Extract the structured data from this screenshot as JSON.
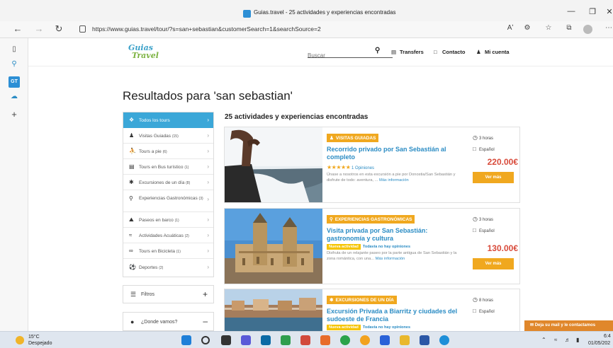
{
  "window": {
    "tab_title": "Guias.travel - 25 actividades y experiencias encontradas",
    "favicon_icon": "gt-favicon"
  },
  "browser": {
    "url": "https://www.guias.travel/tour/?s=san+sebastian&customerSearch=1&searchSource=2",
    "read_aloud": "Aʹ"
  },
  "header": {
    "logo_line1": "Guias",
    "logo_line2": "Travel",
    "search_placeholder": "Buscar",
    "transfers": "Transfers",
    "contacto": "Contacto",
    "mi_cuenta": "Mi cuenta"
  },
  "page": {
    "title": "Resultados para 'san sebastian'",
    "results_count": "25 actividades y experiencias encontradas"
  },
  "categories": [
    {
      "label": "Todos los tours",
      "count": "",
      "icon": "tag-icon",
      "active": true
    },
    {
      "label": "Visitas Guiadas",
      "count": "(15)",
      "icon": "guide-icon"
    },
    {
      "label": "Tours a pie",
      "count": "(6)",
      "icon": "walker-icon"
    },
    {
      "label": "Tours en Bus turístico",
      "count": "(1)",
      "icon": "bus-icon"
    },
    {
      "label": "Excursiones de un día",
      "count": "(8)",
      "icon": "hiker-icon"
    },
    {
      "label": "Experiencias Gastronómicas",
      "count": "(3)",
      "icon": "food-icon"
    },
    {
      "label": "Paseos en barco",
      "count": "(1)",
      "icon": "boat-icon"
    },
    {
      "label": "Actividades Acuáticas",
      "count": "(2)",
      "icon": "water-icon"
    },
    {
      "label": "Tours en Bicicleta",
      "count": "(1)",
      "icon": "bicycle-icon"
    },
    {
      "label": "Deportes",
      "count": "(2)",
      "icon": "sports-icon"
    }
  ],
  "filters": {
    "label": "Filtros",
    "where_placeholder": "¿Donde vamos?"
  },
  "cards": [
    {
      "badge": "Visitas guiadas",
      "title": "Recorrido privado por San Sebastián al completo",
      "rating_text": "1 Opiniones",
      "description": "Únase a nosotros en esta excursión a pie por Donostia/San Sebastián y disfrute de todo: aventura, ...",
      "more": "Más información",
      "duration": "3 horas",
      "language": "Español",
      "price": "220.00€",
      "button": "Ver más"
    },
    {
      "badge": "Experiencias gastronómicas",
      "title": "Visita privada por San Sebastián: gastronomía y cultura",
      "tag_new": "Nueva actividad",
      "tag_noop": "Todavía no hay opiniones",
      "description": "Disfruta de un relajante paseo por la parte antigua de San Sebastián y la zona romántica, con una...",
      "more": "Más información",
      "duration": "3 horas",
      "language": "Español",
      "price": "130.00€",
      "button": "Ver más"
    },
    {
      "badge": "Excursiones de un día",
      "title": "Excursión Privada a Biarritz y ciudades del sudoeste de Francia",
      "tag_new": "Nueva actividad",
      "tag_noop": "Todavía no hay opiniones",
      "duration": "8 horas",
      "language": "Español"
    }
  ],
  "contact_tab": "Deja su mail y le contactamos",
  "taskbar": {
    "temperature": "15°C",
    "weather": "Despejado",
    "time": "6:4",
    "date": "01/05/202"
  },
  "colors": {
    "accent_blue": "#3ba7d8",
    "link_blue": "#2b8cc4",
    "badge_orange": "#f0a81f",
    "price_red": "#d84a3a"
  }
}
